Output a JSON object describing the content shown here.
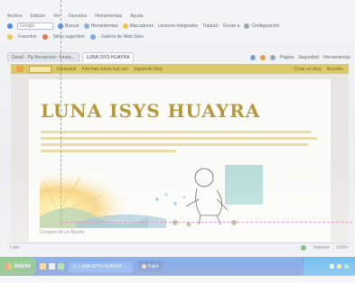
{
  "menu": [
    "Archivo",
    "Edición",
    "Ver",
    "Favoritos",
    "Herramientas",
    "Ayuda"
  ],
  "toolbar": {
    "search_placeholder": "Google",
    "search_label": "Buscar",
    "items": [
      "Herramientas",
      "Marcadores",
      "Lectores integrados",
      "Traducir",
      "Enviar a",
      "Configuración"
    ]
  },
  "toolbar2": {
    "items": [
      "Favoritos",
      "Sitios sugeridos",
      "Galería de Web Slice"
    ]
  },
  "tabs": {
    "items": [
      "Gmail - Pg Recepción - lunisy...",
      "LUNA ISYS HUAYRA"
    ],
    "active_index": 1,
    "tools": [
      "Página",
      "Seguridad",
      "Herramientas"
    ]
  },
  "blogbar": {
    "items": [
      "Compartir",
      "Informar sobre mal uso",
      "Siguiente blog"
    ],
    "right": [
      "Crear un blog",
      "Acceder"
    ]
  },
  "blog": {
    "title": "LUNA ISYS HUAYRA",
    "caption": "Corazón de un Mundo"
  },
  "statusbar": {
    "text": "Listo",
    "zone": "Internet",
    "zoom": "100%"
  },
  "taskbar": {
    "start_label": "inicio",
    "tasks": [
      "LUNA ISYS HUAYRA - ...",
      "Paint"
    ],
    "active_index": 1,
    "clock": ""
  },
  "colors": {
    "title_gold": "#b6983e",
    "blogbar_bg": "#dcc96a",
    "taskbar_blue": "#2460cf",
    "start_green": "#2f8a2f",
    "guide_pink": "#d86aa8"
  }
}
